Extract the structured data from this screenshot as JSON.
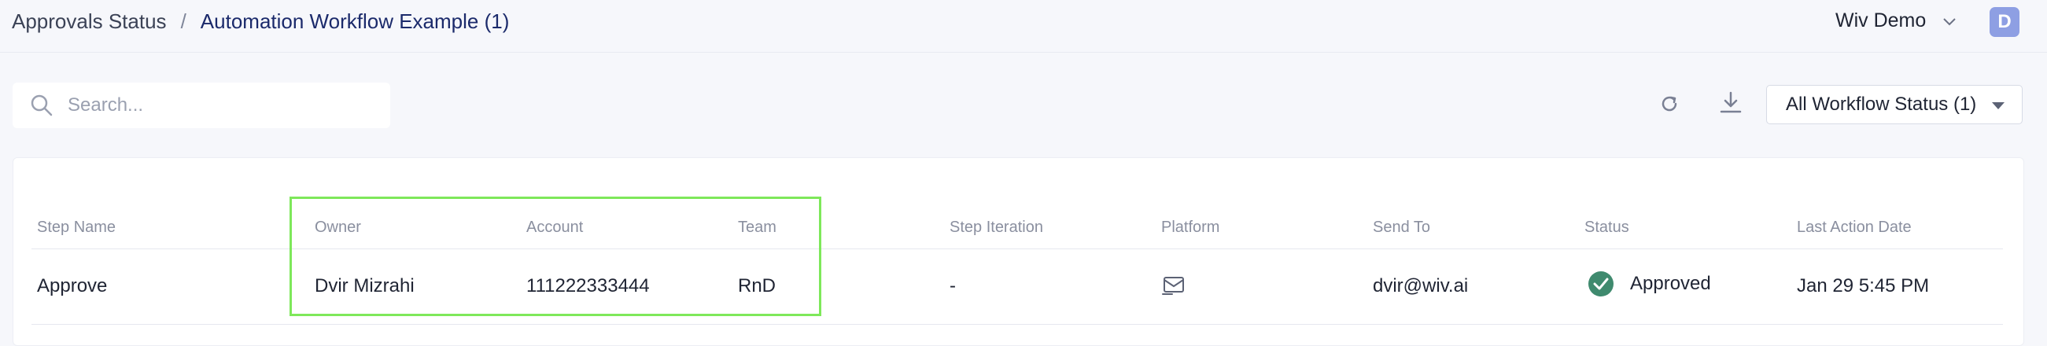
{
  "breadcrumb": {
    "parent": "Approvals Status",
    "separator": "/",
    "current": "Automation Workflow Example (1)"
  },
  "header": {
    "org_name": "Wiv Demo",
    "avatar_initial": "D"
  },
  "toolbar": {
    "search_placeholder": "Search...",
    "status_filter": "All Workflow Status (1)"
  },
  "table": {
    "columns": [
      "Step Name",
      "Owner",
      "Account",
      "Team",
      "Step Iteration",
      "Platform",
      "Send To",
      "Status",
      "Last Action Date"
    ],
    "rows": [
      {
        "step_name": "Approve",
        "owner": "Dvir Mizrahi",
        "account": "111222333444",
        "team": "RnD",
        "step_iteration": "-",
        "platform_icon": "mail-icon",
        "send_to": "dvir@wiv.ai",
        "status": "Approved",
        "status_icon": "check-circle-icon",
        "last_action_date": "Jan 29 5:45 PM"
      }
    ]
  },
  "colors": {
    "highlight": "#7ee85a",
    "approved": "#3f8a6e",
    "avatar": "#8e9fe3",
    "breadcrumb_current": "#1b2a6b"
  }
}
